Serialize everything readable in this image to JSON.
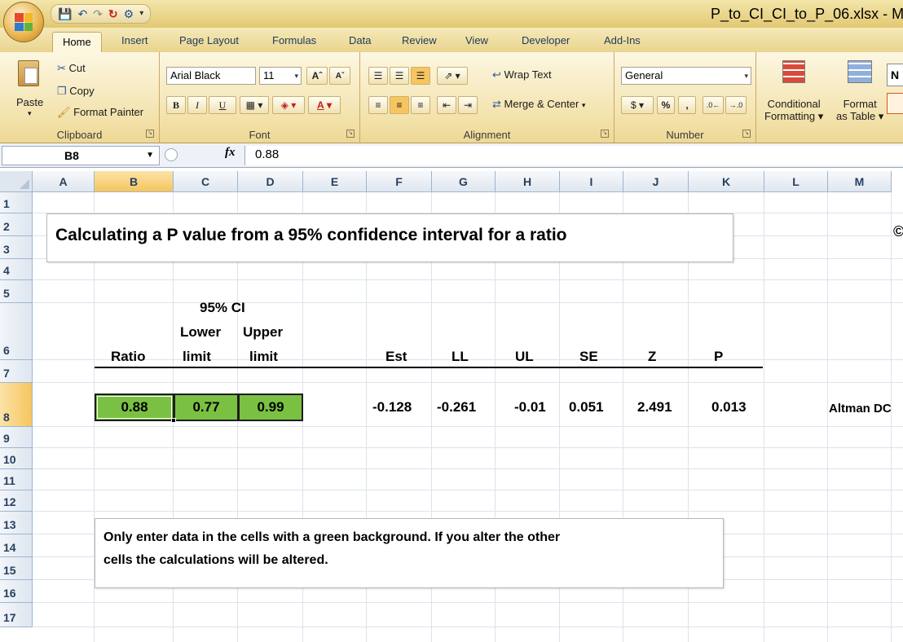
{
  "window": {
    "title": "P_to_CI_CI_to_P_06.xlsx - Mi"
  },
  "qat_icons": [
    "save-icon",
    "undo-icon",
    "redo-icon",
    "customize-icon"
  ],
  "tabs": [
    "Home",
    "Insert",
    "Page Layout",
    "Formulas",
    "Data",
    "Review",
    "View",
    "Developer",
    "Add-Ins"
  ],
  "ribbon": {
    "clipboard": {
      "label": "Clipboard",
      "paste": "Paste",
      "cut": "Cut",
      "copy": "Copy",
      "format_painter": "Format Painter"
    },
    "font": {
      "label": "Font",
      "font_name": "Arial Black",
      "font_size": "11",
      "bold": "B",
      "italic": "I",
      "underline": "U",
      "font_color": "A"
    },
    "alignment": {
      "label": "Alignment",
      "wrap_text": "Wrap Text",
      "merge_center": "Merge & Center"
    },
    "number": {
      "label": "Number",
      "format": "General",
      "percent": "%",
      "comma": ","
    },
    "styles": {
      "conditional_line1": "Conditional",
      "conditional_line2": "Formatting",
      "format_table_line1": "Format",
      "format_table_line2": "as Table",
      "cell_styles_partial": "N"
    }
  },
  "formula_bar": {
    "name_box": "B8",
    "fx": "fx",
    "value": "0.88"
  },
  "columns": [
    "A",
    "B",
    "C",
    "D",
    "E",
    "F",
    "G",
    "H",
    "I",
    "J",
    "K",
    "L",
    "M"
  ],
  "selected_column": "B",
  "rows": [
    "1",
    "2",
    "3",
    "4",
    "5",
    "6",
    "7",
    "8",
    "9",
    "10",
    "11",
    "12",
    "13",
    "14",
    "15",
    "16",
    "17"
  ],
  "selected_row": "8",
  "sheet": {
    "title_box": "Calculating a P value from a 95% confidence interval for a ratio",
    "ci_header": "95% CI",
    "headers": {
      "ratio": "Ratio",
      "lower_1": "Lower",
      "lower_2": "limit",
      "upper_1": "Upper",
      "upper_2": "limit",
      "est": "Est",
      "ll": "LL",
      "ul": "UL",
      "se": "SE",
      "z": "Z",
      "p": "P"
    },
    "inputs": {
      "ratio": "0.88",
      "lower": "0.77",
      "upper": "0.99"
    },
    "results": {
      "est": "-0.128",
      "ll": "-0.261",
      "ul": "-0.01",
      "se": "0.051",
      "z": "2.491",
      "p": "0.013"
    },
    "reference": "Altman DC",
    "edge_symbol": "©",
    "note_line1": "Only enter data in the cells with a green background. If you alter the other",
    "note_line2": "cells the calculations will be altered."
  },
  "colors": {
    "input_green": "#7ac143",
    "selection": "#f6c55d"
  }
}
